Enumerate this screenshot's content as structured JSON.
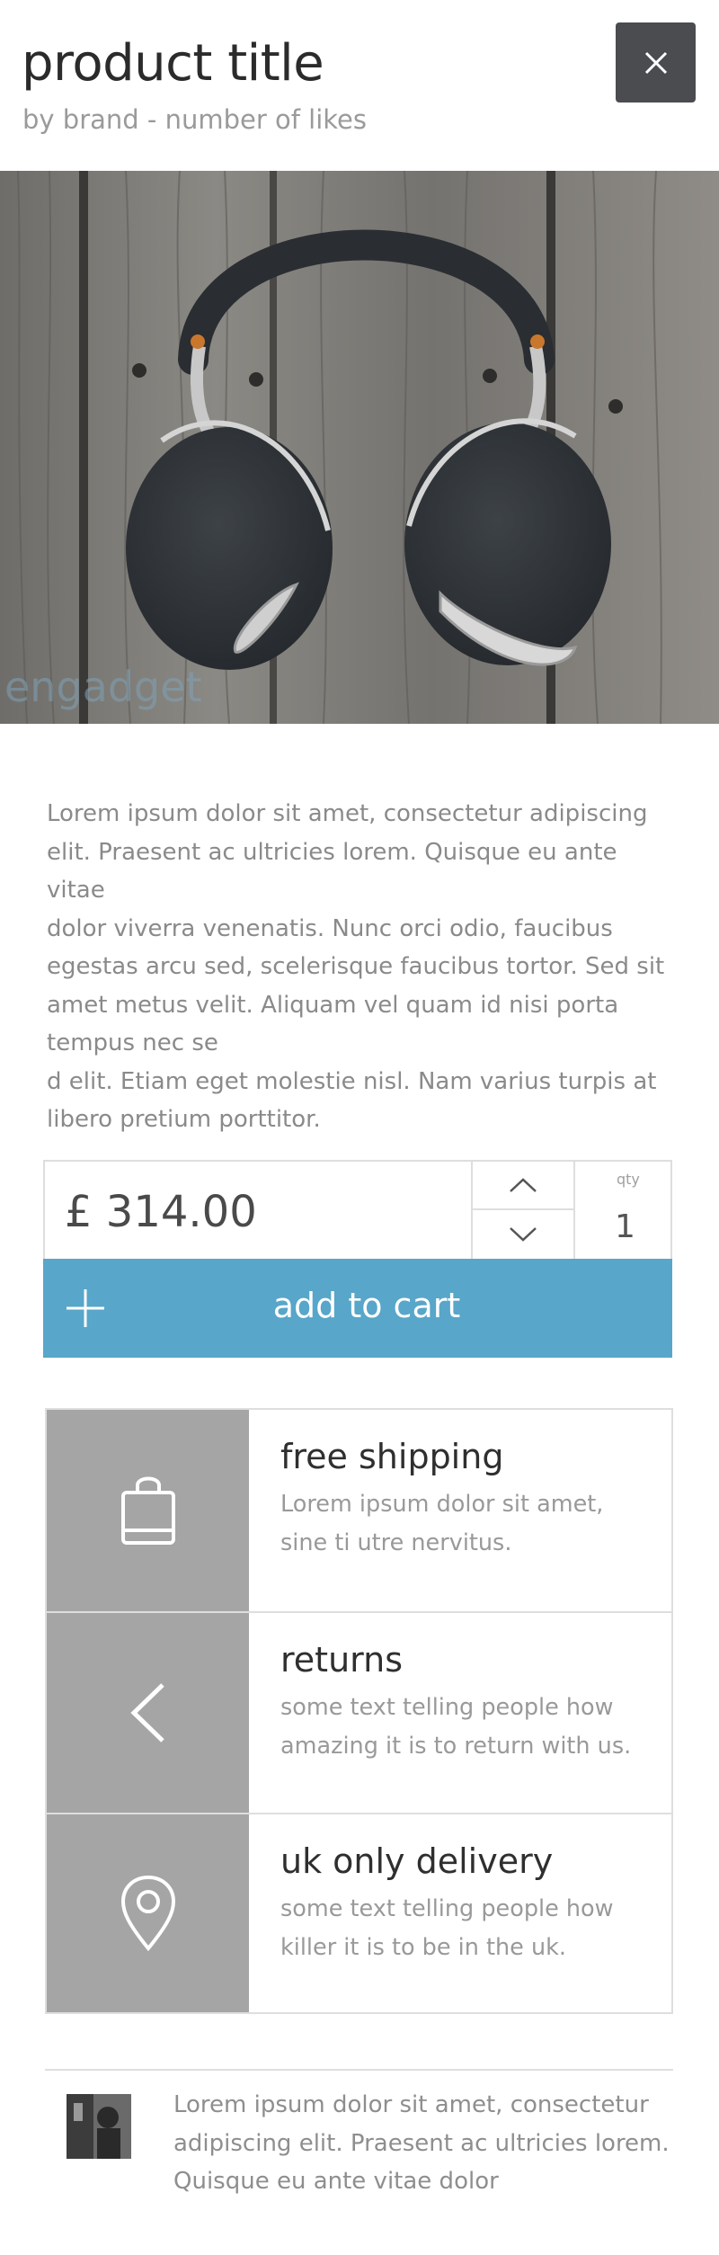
{
  "product": {
    "title": "product title",
    "subtitle": "by brand - number of likes"
  },
  "header": {
    "close_icon": "close-icon"
  },
  "hero": {
    "image_subject": "headphones",
    "watermark": "engadget"
  },
  "description": {
    "lines": [
      "Lorem ipsum dolor sit amet, consectetur adipiscing",
      "elit. Praesent ac ultricies lorem. Quisque eu ante vitae",
      "dolor viverra venenatis. Nunc orci odio, faucibus",
      "egestas arcu sed, scelerisque faucibus tortor. Sed sit",
      "amet metus velit. Aliquam vel quam id nisi porta",
      "tempus nec se",
      "d elit. Etiam eget molestie nisl. Nam varius turpis at",
      "libero pretium porttitor."
    ]
  },
  "purchase": {
    "price": "£ 314.00",
    "qty_label": "qty",
    "qty_value": "1",
    "add_to_cart_label": "add to cart",
    "accent_color": "#58a6c9"
  },
  "features": [
    {
      "icon": "shopping-bag-icon",
      "title": "free shipping",
      "lines": [
        "Lorem ipsum dolor sit amet,",
        "sine ti utre nervitus."
      ]
    },
    {
      "icon": "chevron-left-icon",
      "title": "returns",
      "lines": [
        "some text telling people how",
        "amazing it is to return with us."
      ]
    },
    {
      "icon": "map-pin-icon",
      "title": "uk only delivery",
      "lines": [
        "some text telling people how",
        "killer it is to be in the uk."
      ]
    }
  ],
  "review": {
    "lines": [
      "Lorem ipsum dolor sit amet, consectetur",
      "adipiscing elit. Praesent ac ultricies lorem.",
      "Quisque eu ante vitae dolor"
    ]
  }
}
